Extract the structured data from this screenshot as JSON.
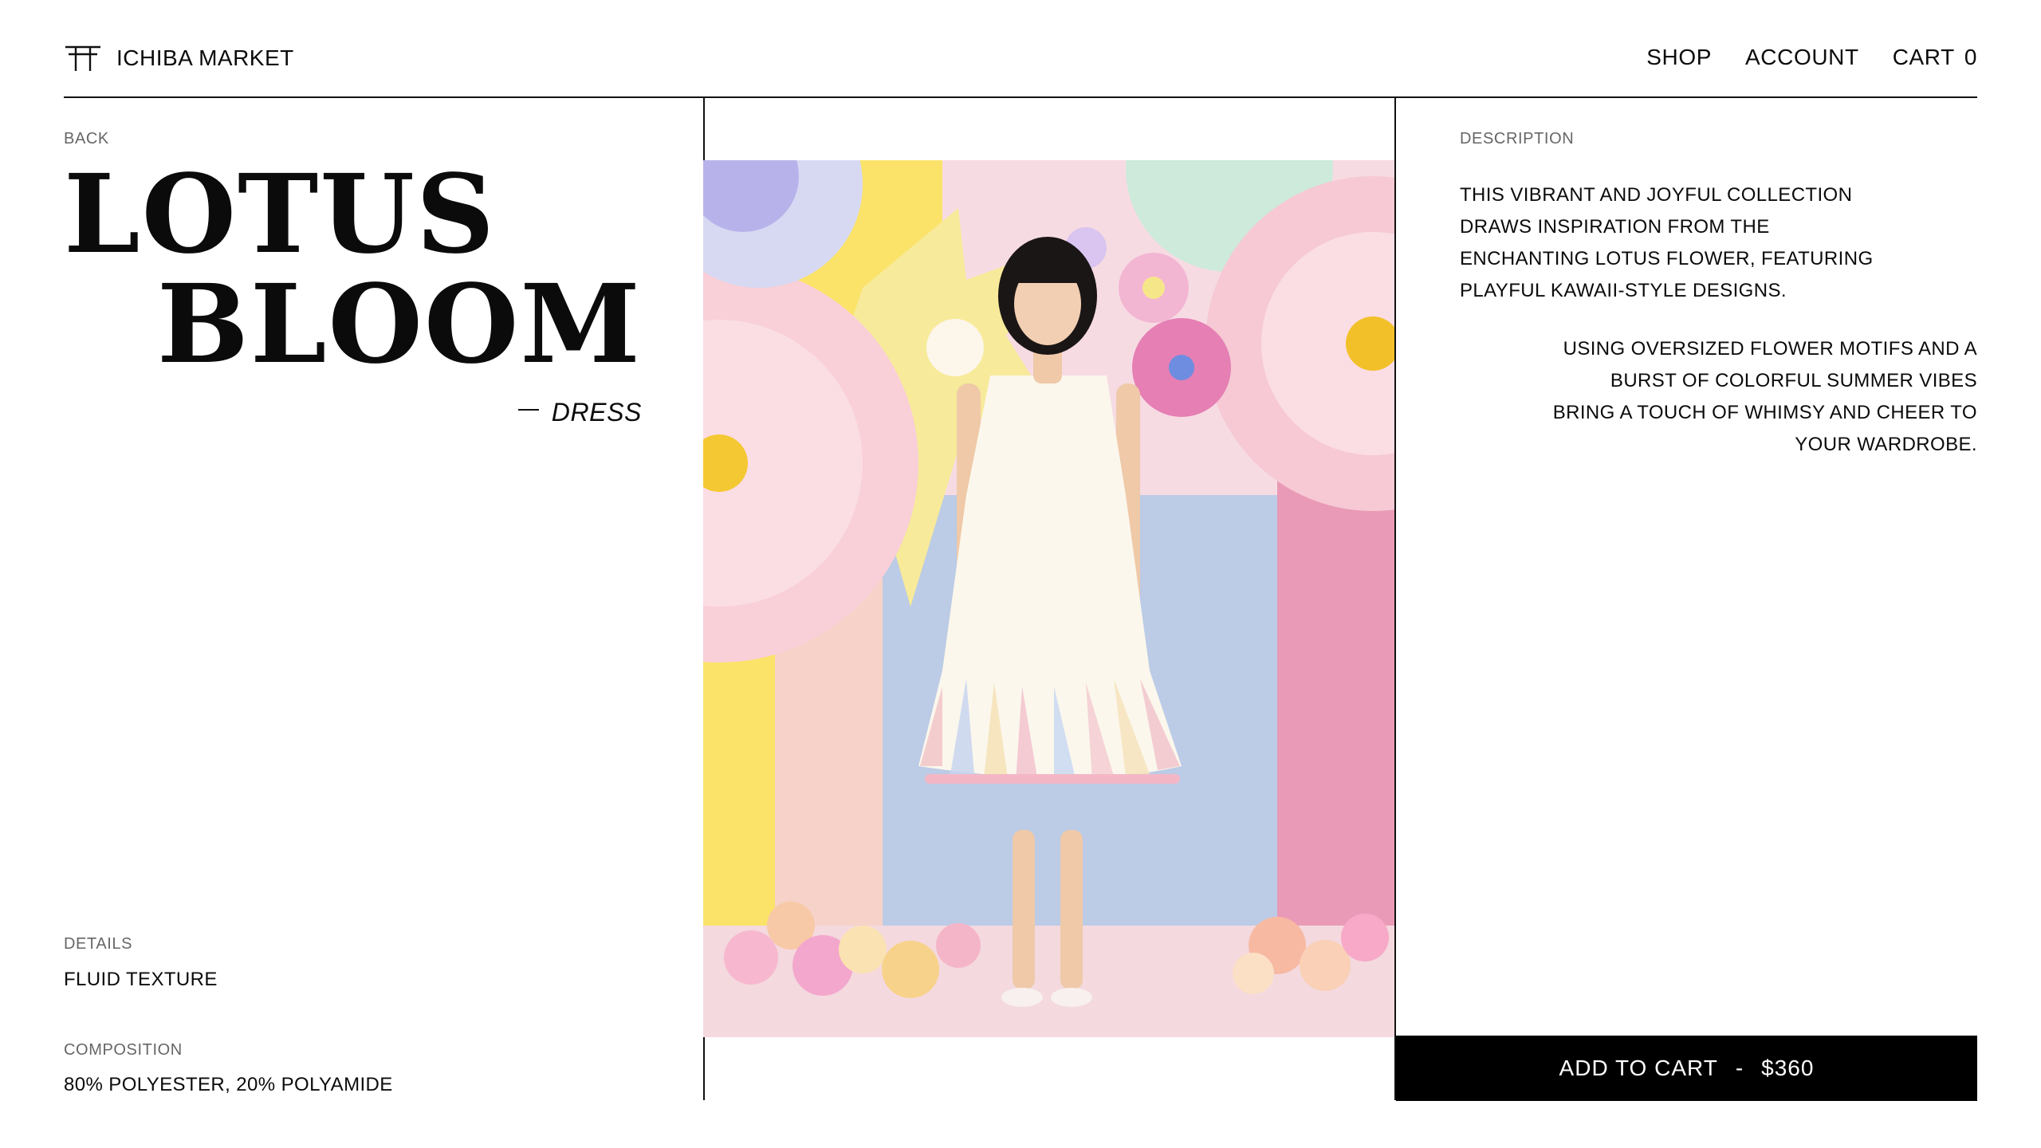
{
  "brand": {
    "name": "ICHIBA MARKET",
    "icon": "torii-gate-icon"
  },
  "nav": {
    "shop": "SHOP",
    "account": "ACCOUNT",
    "cart_label": "CART",
    "cart_count": "0"
  },
  "product": {
    "back_label": "BACK",
    "title_line1": "LOTUS",
    "title_line2": "BLOOM",
    "category": "DRESS",
    "details_label": "DETAILS",
    "details_value": "FLUID TEXTURE",
    "composition_label": "COMPOSITION",
    "composition_value": "80% POLYESTER, 20% POLYAMIDE",
    "image_subject": "model-in-white-pleated-dress-with-giant-paper-flowers"
  },
  "description": {
    "label": "DESCRIPTION",
    "paragraph1_lines": [
      "THIS VIBRANT AND JOYFUL COLLECTION",
      "DRAWS INSPIRATION FROM THE",
      "ENCHANTING LOTUS FLOWER, FEATURING",
      "PLAYFUL KAWAII-STYLE DESIGNS."
    ],
    "paragraph2_lines": [
      "USING OVERSIZED FLOWER MOTIFS AND A",
      "BURST OF COLORFUL SUMMER VIBES",
      "BRING A TOUCH OF WHIMSY AND CHEER TO",
      "YOUR WARDROBE."
    ]
  },
  "cta": {
    "label": "ADD TO CART",
    "separator": "-",
    "price": "$360"
  },
  "colors": {
    "accent": "#000000",
    "text": "#0b0b0b",
    "muted": "#666666",
    "background": "#ffffff"
  }
}
